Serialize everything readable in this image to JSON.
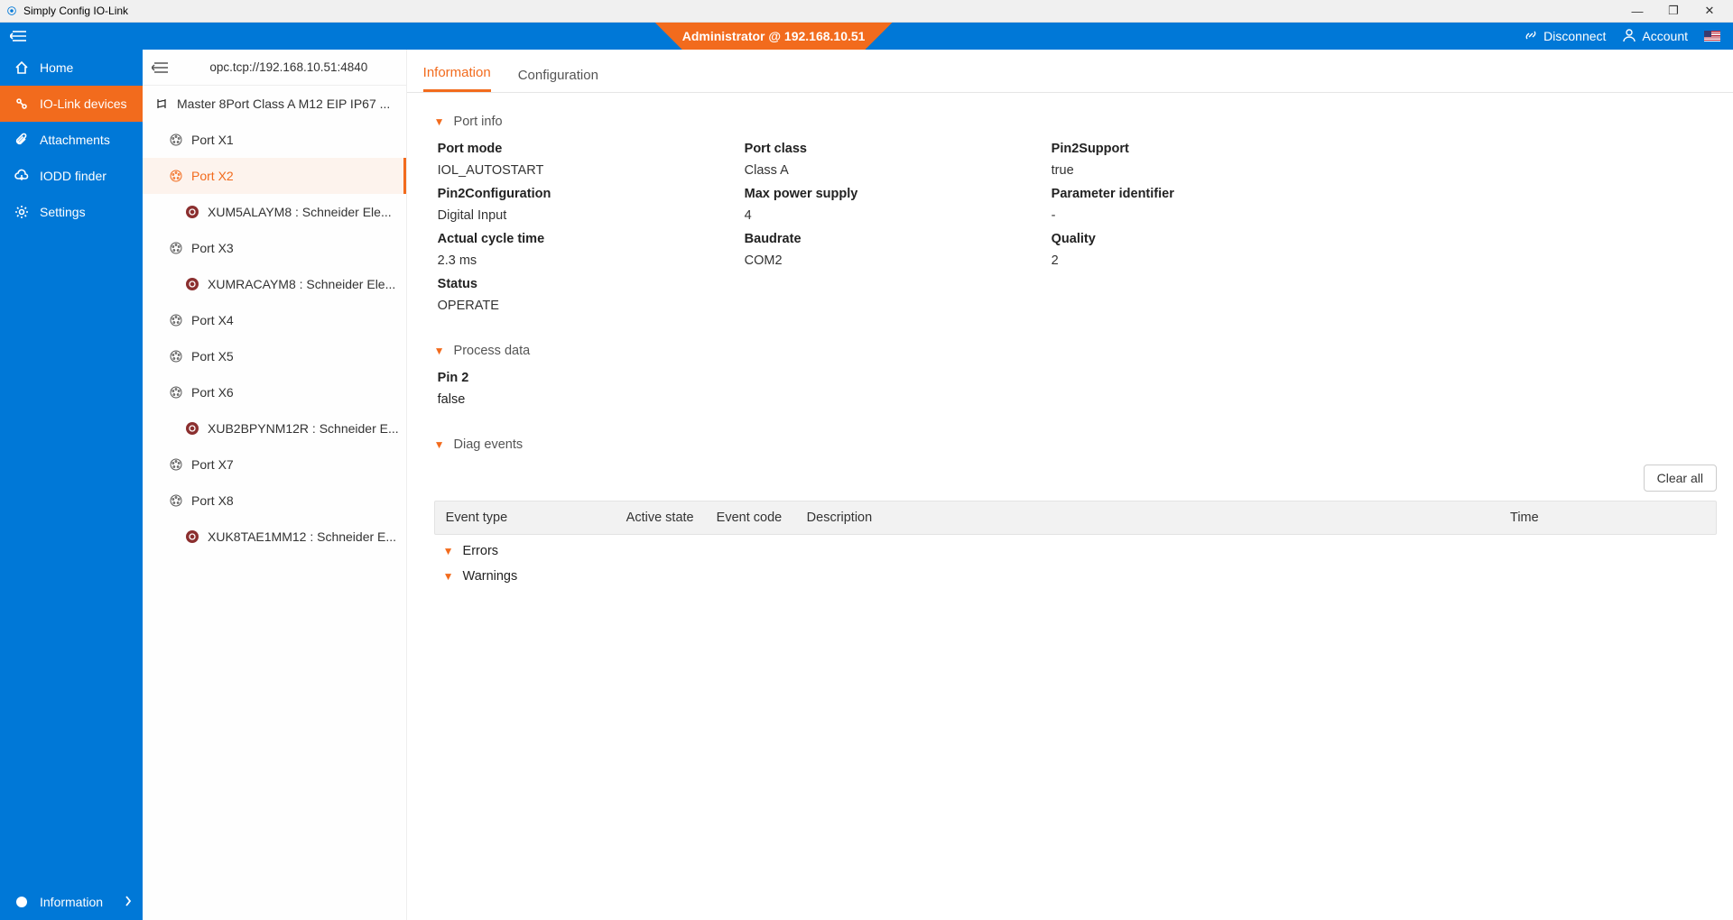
{
  "window": {
    "title": "Simply Config IO-Link"
  },
  "topbar": {
    "banner": "Administrator @ 192.168.10.51",
    "disconnect": "Disconnect",
    "account": "Account"
  },
  "nav": {
    "home": "Home",
    "iolink": "IO-Link devices",
    "attachments": "Attachments",
    "iodd": "IODD finder",
    "settings": "Settings",
    "information": "Information"
  },
  "tree": {
    "address": "opc.tcp://192.168.10.51:4840",
    "master": "Master 8Port Class A M12 EIP IP67 ...",
    "items": [
      {
        "type": "port",
        "label": "Port X1",
        "selected": false
      },
      {
        "type": "port",
        "label": "Port X2",
        "selected": true
      },
      {
        "type": "device",
        "label": "XUM5ALAYM8 : Schneider Ele..."
      },
      {
        "type": "port",
        "label": "Port X3"
      },
      {
        "type": "device",
        "label": "XUMRACAYM8 : Schneider Ele..."
      },
      {
        "type": "port",
        "label": "Port X4"
      },
      {
        "type": "port",
        "label": "Port X5"
      },
      {
        "type": "port",
        "label": "Port X6"
      },
      {
        "type": "device",
        "label": "XUB2BPYNM12R : Schneider E..."
      },
      {
        "type": "port",
        "label": "Port X7"
      },
      {
        "type": "port",
        "label": "Port X8"
      },
      {
        "type": "device",
        "label": "XUK8TAE1MM12 : Schneider E..."
      }
    ]
  },
  "tabs": {
    "information": "Information",
    "configuration": "Configuration"
  },
  "sections": {
    "port_info": "Port info",
    "process_data": "Process data",
    "diag_events": "Diag events",
    "errors": "Errors",
    "warnings": "Warnings"
  },
  "port_info": {
    "labels": {
      "port_mode": "Port mode",
      "port_class": "Port class",
      "pin2support": "Pin2Support",
      "pin2config": "Pin2Configuration",
      "max_power": "Max power supply",
      "param_id": "Parameter identifier",
      "cycle_time": "Actual cycle time",
      "baudrate": "Baudrate",
      "quality": "Quality",
      "status": "Status"
    },
    "values": {
      "port_mode": "IOL_AUTOSTART",
      "port_class": "Class A",
      "pin2support": "true",
      "pin2config": "Digital Input",
      "max_power": "4",
      "param_id": "-",
      "cycle_time": "2.3 ms",
      "baudrate": "COM2",
      "quality": "2",
      "status": "OPERATE"
    }
  },
  "process_data": {
    "pin2_label": "Pin 2",
    "pin2_value": "false"
  },
  "diag": {
    "clear_all": "Clear all",
    "columns": {
      "event_type": "Event type",
      "active_state": "Active state",
      "event_code": "Event code",
      "description": "Description",
      "time": "Time"
    }
  }
}
